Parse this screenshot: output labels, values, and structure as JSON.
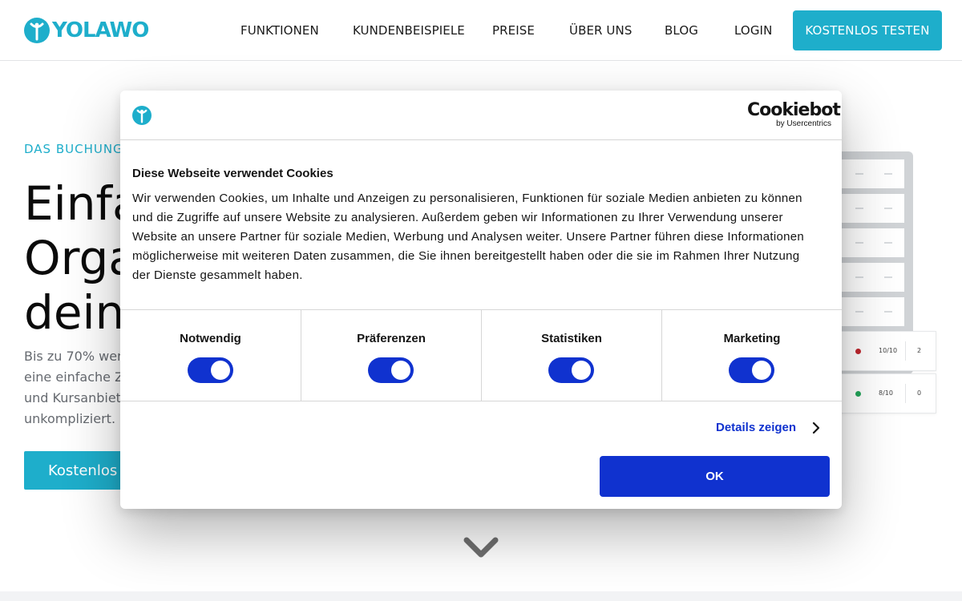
{
  "header": {
    "brand": "YOLAWO",
    "nav": [
      "FUNKTIONEN",
      "KUNDENBEISPIELE",
      "PREISE",
      "ÜBER UNS",
      "BLOG",
      "LOGIN"
    ],
    "cta": "KOSTENLOS TESTEN"
  },
  "hero": {
    "eyebrow": "DAS BUCHUNG",
    "title_lines": [
      "Einfa",
      "Orga",
      "dein"
    ],
    "text_lines": [
      "Bis zu 70% wenig",
      "eine einfache Za",
      "und Kursanbieter",
      "unkompliziert."
    ],
    "cta": "Kostenlos",
    "stats": [
      {
        "ratio": "10/10",
        "count": "2",
        "dot_color": "#c0262d"
      },
      {
        "ratio": "8/10",
        "count": "0",
        "dot_color": "#23a55a"
      }
    ]
  },
  "cookie_dialog": {
    "brand_name": "Cookiebot",
    "brand_sub": "by Usercentrics",
    "title": "Diese Webseite verwendet Cookies",
    "body_lines": [
      "Wir verwenden Cookies, um Inhalte und Anzeigen zu personalisieren, Funktionen für soziale Medien anbieten zu können",
      "und die Zugriffe auf unsere Website zu analysieren. Außerdem geben wir Informationen zu Ihrer Verwendung unserer",
      "Website an unsere Partner für soziale Medien, Werbung und Analysen weiter. Unsere Partner führen diese Informationen",
      "möglicherweise mit weiteren Daten zusammen, die Sie ihnen bereitgestellt haben oder die sie im Rahmen Ihrer Nutzung",
      "der Dienste gesammelt haben."
    ],
    "categories": [
      {
        "label": "Notwendig",
        "enabled": true
      },
      {
        "label": "Präferenzen",
        "enabled": true
      },
      {
        "label": "Statistiken",
        "enabled": true
      },
      {
        "label": "Marketing",
        "enabled": true
      }
    ],
    "details_link": "Details zeigen",
    "ok_button": "OK"
  },
  "colors": {
    "brand": "#1eaecb",
    "cookiebot_blue": "#1032cf"
  }
}
